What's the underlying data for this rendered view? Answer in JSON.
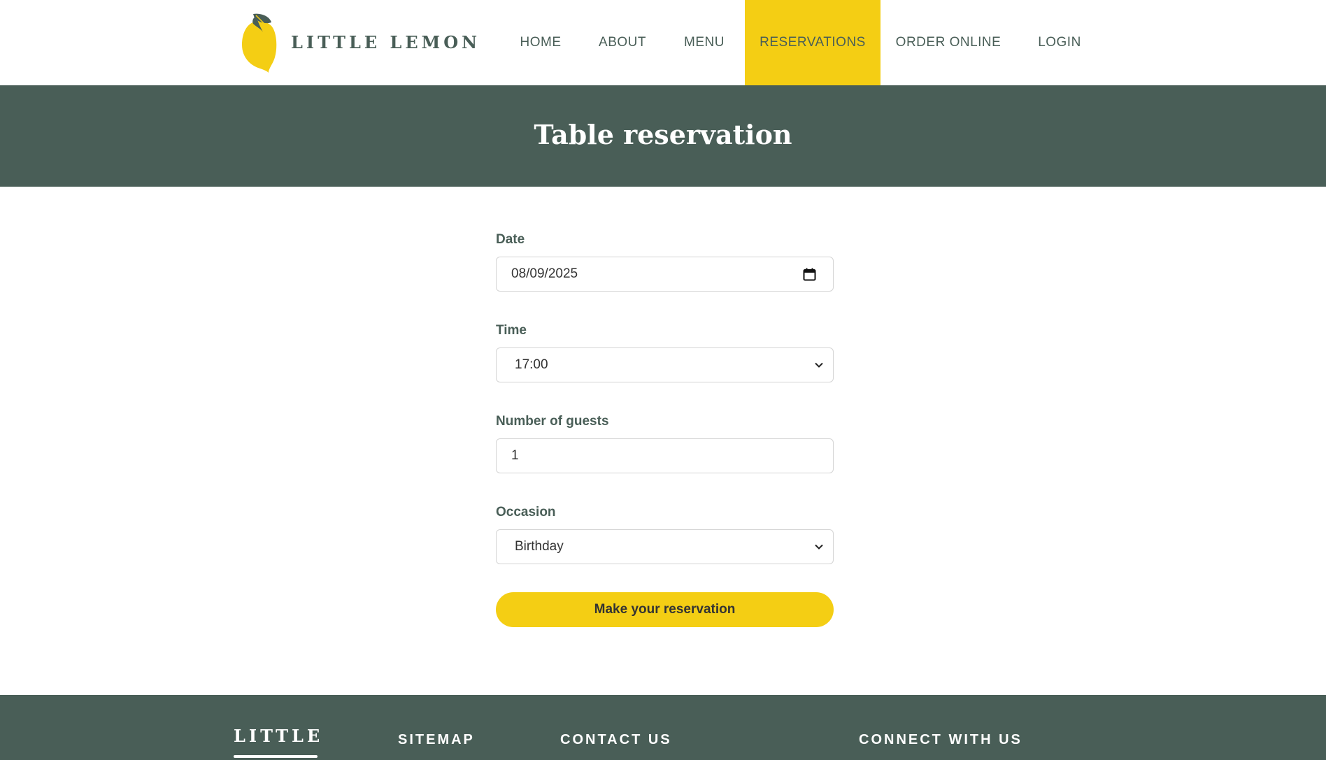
{
  "brand": {
    "name": "LITTLE LEMON",
    "logo_icon": "lemon-icon",
    "colors": {
      "primary_green": "#495e57",
      "primary_yellow": "#f4ce14",
      "text_dark": "#333333",
      "background": "#ffffff"
    }
  },
  "nav": {
    "items": [
      {
        "label": "HOME"
      },
      {
        "label": "ABOUT"
      },
      {
        "label": "MENU"
      },
      {
        "label": "RESERVATIONS",
        "active": true
      },
      {
        "label": "ORDER ONLINE"
      },
      {
        "label": "LOGIN"
      }
    ]
  },
  "banner": {
    "title": "Table reservation"
  },
  "form": {
    "date": {
      "label": "Date",
      "value": "08/09/2025",
      "icon": "calendar-icon"
    },
    "time": {
      "label": "Time",
      "value": "17:00",
      "icon": "chevron-down-icon"
    },
    "guests": {
      "label": "Number of guests",
      "value": "1"
    },
    "occasion": {
      "label": "Occasion",
      "value": "Birthday",
      "icon": "chevron-down-icon"
    },
    "submit_label": "Make your reservation"
  },
  "footer": {
    "logo_text": "LITTLE",
    "sitemap_heading": "SITEMAP",
    "contact_heading": "CONTACT US",
    "connect_heading": "CONNECT WITH US"
  }
}
